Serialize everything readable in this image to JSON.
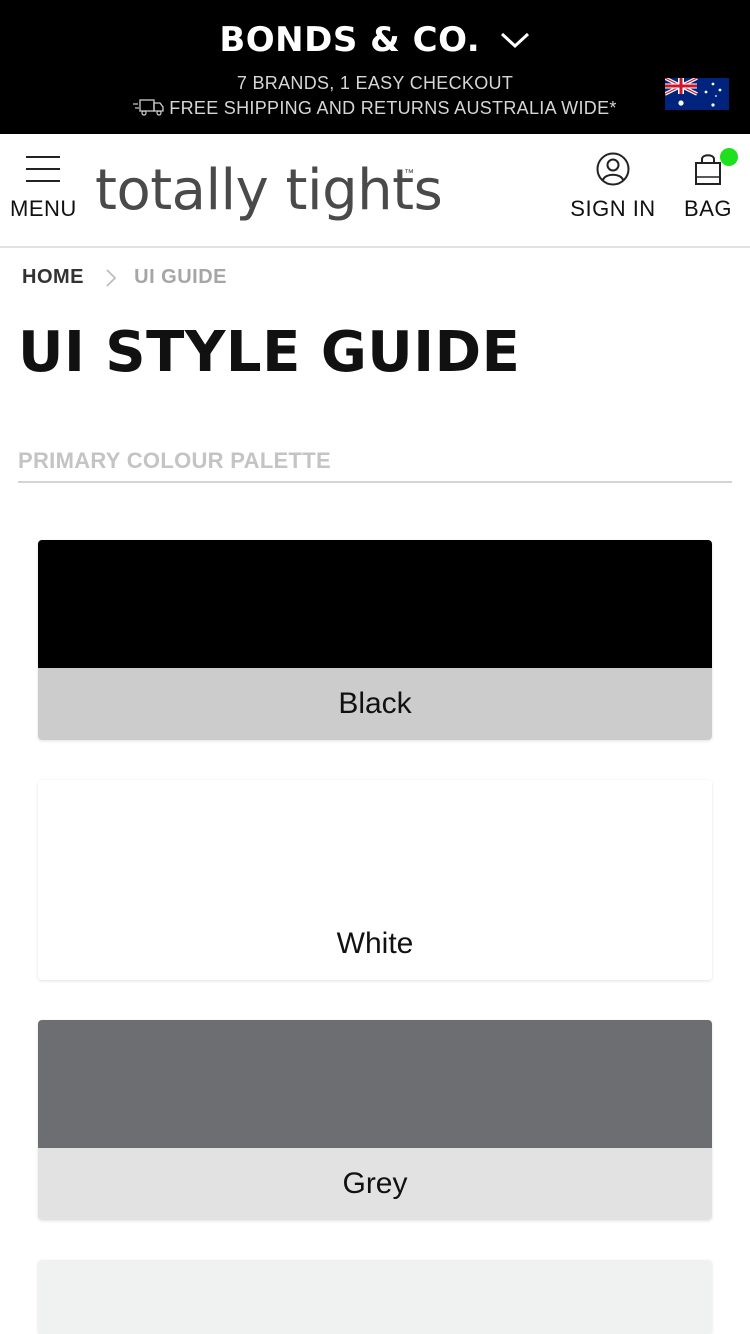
{
  "topbar": {
    "brand": "BONDS & CO.",
    "tagline": "7 BRANDS, 1 EASY CHECKOUT",
    "shipping": "FREE SHIPPING AND RETURNS AUSTRALIA WIDE*",
    "icons": [
      "chevron-down-icon",
      "truck-icon",
      "australia-flag-icon"
    ]
  },
  "header": {
    "menu_label": "MENU",
    "logo_text": "totally tights",
    "logo_tm": "™",
    "signin_label": "SIGN IN",
    "bag_label": "BAG",
    "bag_indicator_color": "#1fe01f",
    "icons": [
      "hamburger-icon",
      "user-icon",
      "shopping-bag-icon"
    ]
  },
  "breadcrumb": {
    "home": "HOME",
    "current": "UI GUIDE"
  },
  "page": {
    "title": "UI STYLE GUIDE",
    "section_heading": "PRIMARY COLOUR PALETTE"
  },
  "swatches": [
    {
      "name": "Black",
      "color": "#000000",
      "label_bg": "#cccccc"
    },
    {
      "name": "White",
      "color": "#ffffff",
      "label_bg": "#ffffff"
    },
    {
      "name": "Grey",
      "color": "#6d6e71",
      "label_bg": "#e2e2e2"
    },
    {
      "name": "",
      "color": "#f0f1f1",
      "label_bg": "#f0f1f1"
    }
  ]
}
